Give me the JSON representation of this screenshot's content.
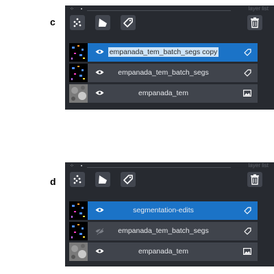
{
  "panels": [
    {
      "letter": "c",
      "title": "layer list",
      "layers": [
        {
          "name": "empanada_tem_batch_segs copy",
          "type": "labels",
          "visible": true,
          "selected": true,
          "highlighted": true
        },
        {
          "name": "empanada_tem_batch_segs",
          "type": "labels",
          "visible": true,
          "selected": false
        },
        {
          "name": "empanada_tem",
          "type": "image",
          "visible": true,
          "selected": false
        }
      ]
    },
    {
      "letter": "d",
      "title": "layer list",
      "layers": [
        {
          "name": "segmentation-edits",
          "type": "labels",
          "visible": true,
          "selected": true
        },
        {
          "name": "empanada_tem_batch_segs",
          "type": "labels",
          "visible": false,
          "selected": false
        },
        {
          "name": "empanada_tem",
          "type": "image",
          "visible": true,
          "selected": false
        }
      ]
    }
  ],
  "colors": {
    "panel_bg": "#272a30",
    "row_bg": "#40444c",
    "selected_bg": "#1b73c7",
    "button_bg": "#42464f",
    "text": "#e8eaee"
  },
  "icons": [
    "points-icon",
    "shapes-icon",
    "labels-icon",
    "delete-icon",
    "eye-icon",
    "eye-hidden-icon",
    "label-tag-icon",
    "image-icon"
  ]
}
